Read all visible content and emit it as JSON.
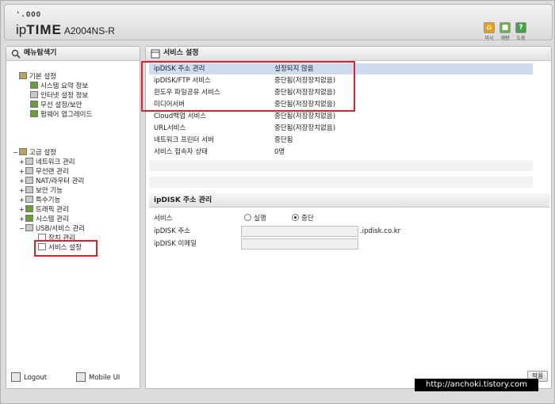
{
  "header": {
    "dots": "'.OOO",
    "brand_ip": "ip",
    "brand_time": "TIME",
    "model": "A2004NS-R",
    "toolbar": [
      {
        "label": "미시",
        "icon": "home-icon",
        "color": "#e6a11c"
      },
      {
        "label": "재량",
        "icon": "save-icon",
        "color": "#6cb04a"
      },
      {
        "label": "도움",
        "icon": "help-icon",
        "color": "#4aa048"
      }
    ]
  },
  "sidebar": {
    "title": "메뉴탐색기",
    "basic": {
      "label": "기본 설정",
      "items": [
        "시스템 요약 정보",
        "인터넷 설정 정보",
        "무선 설정/보안",
        "펌웨어 업그레이드"
      ]
    },
    "advanced": {
      "label": "고급 설정",
      "items": [
        "네트워크 관리",
        "무선랜 관리",
        "NAT/라우터 관리",
        "보안 기능",
        "특수기능",
        "트래픽 관리",
        "시스템 관리",
        "USB/서비스 관리"
      ],
      "usb_children": [
        "장치 관리",
        "서비스 설정"
      ]
    },
    "logout": "Logout",
    "mobile": "Mobile UI"
  },
  "main": {
    "title": "서비스 설정",
    "services": [
      {
        "name": "ipDISK 주소 관리",
        "status": "설정되지 않음"
      },
      {
        "name": "ipDISK/FTP 서비스",
        "status": "중단됨(저장장치없음)"
      },
      {
        "name": "윈도우 파일공유 서비스",
        "status": "중단됨(저장장치없음)"
      },
      {
        "name": "미디어서버",
        "status": "중단됨(저장장치없음)"
      },
      {
        "name": "Cloud백업 서비스",
        "status": "중단됨(저장장치없음)"
      },
      {
        "name": "URL서비스",
        "status": "중단됨(저장장치없음)"
      },
      {
        "name": "네트워크 프린터 서버",
        "status": "중단됨"
      },
      {
        "name": "서비스 접속자 상태",
        "status": "0명"
      }
    ],
    "section_title": "ipDISK 주소 관리",
    "service_label": "서비스",
    "radio_run": "실행",
    "radio_stop": "중단",
    "addr_label": "ipDISK 주소",
    "addr_suffix": ".ipdisk.co.kr",
    "email_label": "ipDISK 이메일",
    "apply": "적용"
  },
  "watermark": "http://anchoki.tistory.com",
  "colors": {
    "highlight": "#e0202a",
    "selected_row": "#cfdcf0"
  }
}
